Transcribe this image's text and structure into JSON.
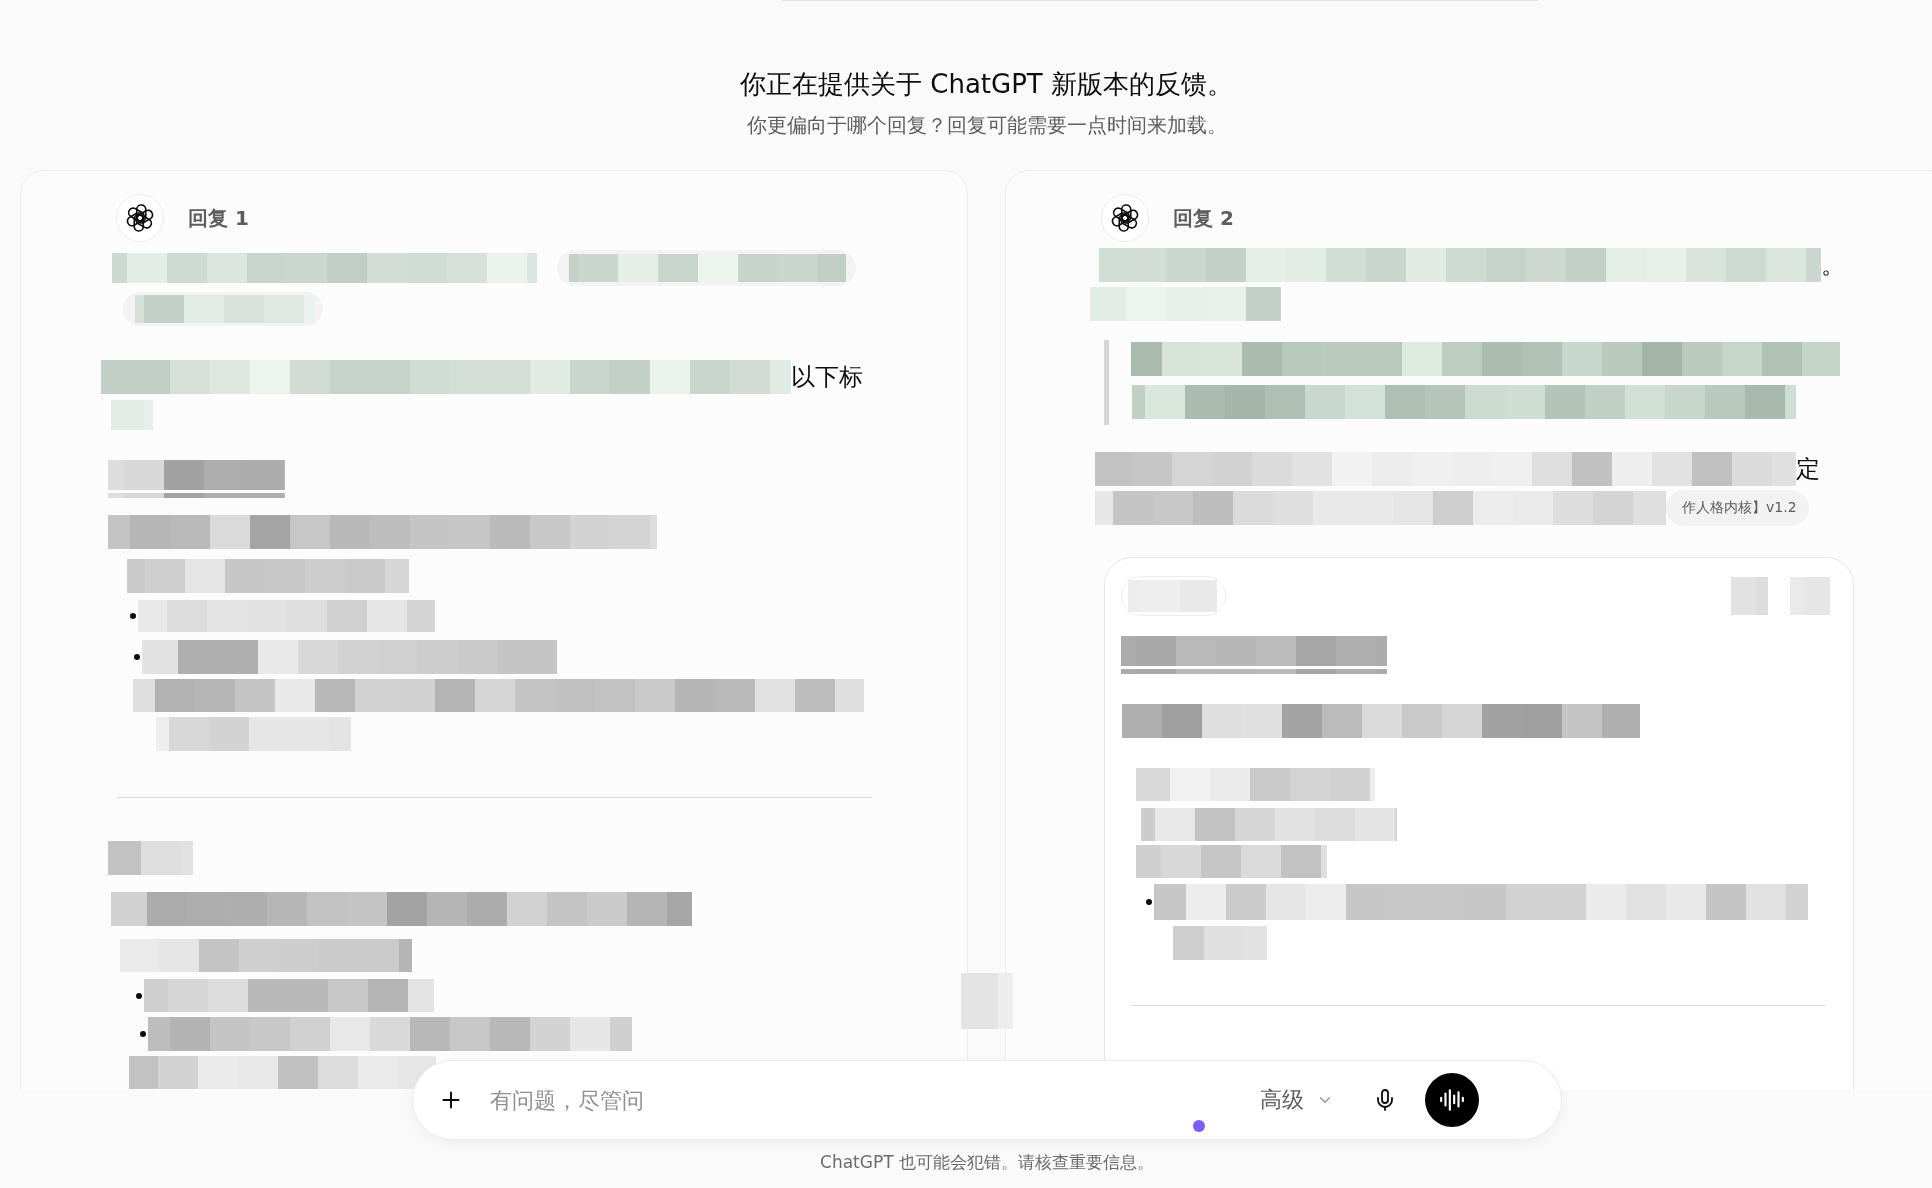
{
  "header": {
    "title": "你正在提供关于 ChatGPT 新版本的反馈。",
    "subtitle": "你更偏向于哪个回复？回复可能需要一点时间来加载。"
  },
  "responses": [
    {
      "label": "回复 1",
      "blocks": [
        {
          "kind": "line_with_chip"
        },
        {
          "kind": "chip"
        },
        {
          "kind": "line",
          "tail": "以下标"
        },
        {
          "kind": "line"
        },
        {
          "kind": "heading"
        },
        {
          "kind": "line"
        },
        {
          "kind": "line"
        },
        {
          "kind": "bullet"
        },
        {
          "kind": "bullet"
        },
        {
          "kind": "line"
        },
        {
          "kind": "line"
        },
        {
          "kind": "divider"
        },
        {
          "kind": "line"
        },
        {
          "kind": "line"
        },
        {
          "kind": "line"
        },
        {
          "kind": "bullet"
        },
        {
          "kind": "bullet"
        },
        {
          "kind": "line"
        }
      ]
    },
    {
      "label": "回复 2",
      "blocks": [
        {
          "kind": "line",
          "tail": "。"
        },
        {
          "kind": "line"
        },
        {
          "kind": "quote",
          "blocks": [
            {
              "kind": "line"
            },
            {
              "kind": "line"
            }
          ]
        },
        {
          "kind": "line",
          "tail": "定"
        },
        {
          "kind": "line",
          "citation": "作人格内核】v1.2"
        },
        {
          "kind": "card",
          "blocks": [
            {
              "kind": "toolbar"
            },
            {
              "kind": "heading"
            },
            {
              "kind": "line"
            },
            {
              "kind": "line"
            },
            {
              "kind": "line"
            },
            {
              "kind": "line"
            },
            {
              "kind": "bullet"
            },
            {
              "kind": "line"
            },
            {
              "kind": "divider"
            }
          ]
        }
      ]
    }
  ],
  "composer": {
    "placeholder": "有问题，尽管问",
    "model": "高级"
  },
  "disclaimer": "ChatGPT 也可能会犯错。请核查重要信息。"
}
